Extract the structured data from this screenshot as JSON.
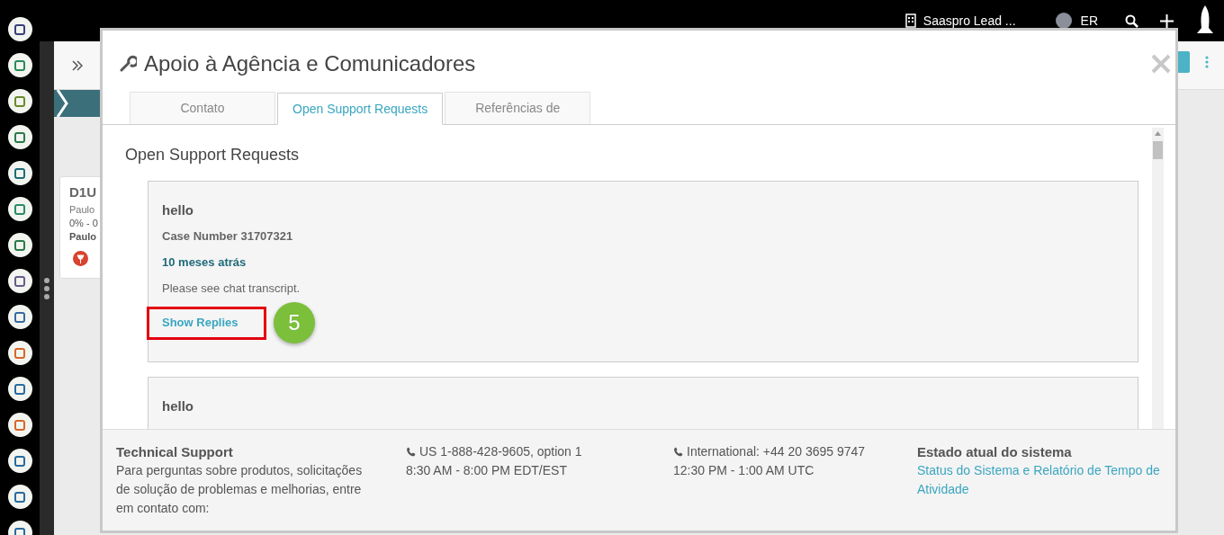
{
  "top_bar": {
    "account": "Saaspro Lead ...",
    "user_initials": "ER"
  },
  "background_card": {
    "title": "D1U",
    "line_1": "Paulo",
    "line_2": "0% - 0",
    "line_3": "Paulo"
  },
  "modal": {
    "title": "Apoio à Agência e Comunicadores",
    "tabs": [
      {
        "label": "Contato",
        "selected": false
      },
      {
        "label": "Open Support Requests",
        "selected": true
      },
      {
        "label": "Referências de",
        "selected": false
      }
    ],
    "section_title": "Open Support Requests",
    "requests": [
      {
        "subject": "hello",
        "case_number": "Case Number 31707321",
        "age": "10 meses atrás",
        "message": "Please see chat transcript.",
        "action": "Show Replies",
        "highlighted": true,
        "step": "5"
      },
      {
        "subject": "hello"
      }
    ],
    "footer": {
      "support_title": "Technical Support",
      "support_text": "Para perguntas sobre produtos, solicitações de solução de problemas e melhorias, entre em contato com:",
      "us_phone": "US 1-888-428-9605, option 1",
      "us_hours": "8:30 AM - 8:00 PM EDT/EST",
      "intl_phone": "International: +44 20 3695 9747",
      "intl_hours": "12:30 PM - 1:00 AM UTC",
      "status_title": "Estado atual do sistema",
      "status_link": "Status do Sistema e Relatório de Tempo de Atividade"
    }
  }
}
